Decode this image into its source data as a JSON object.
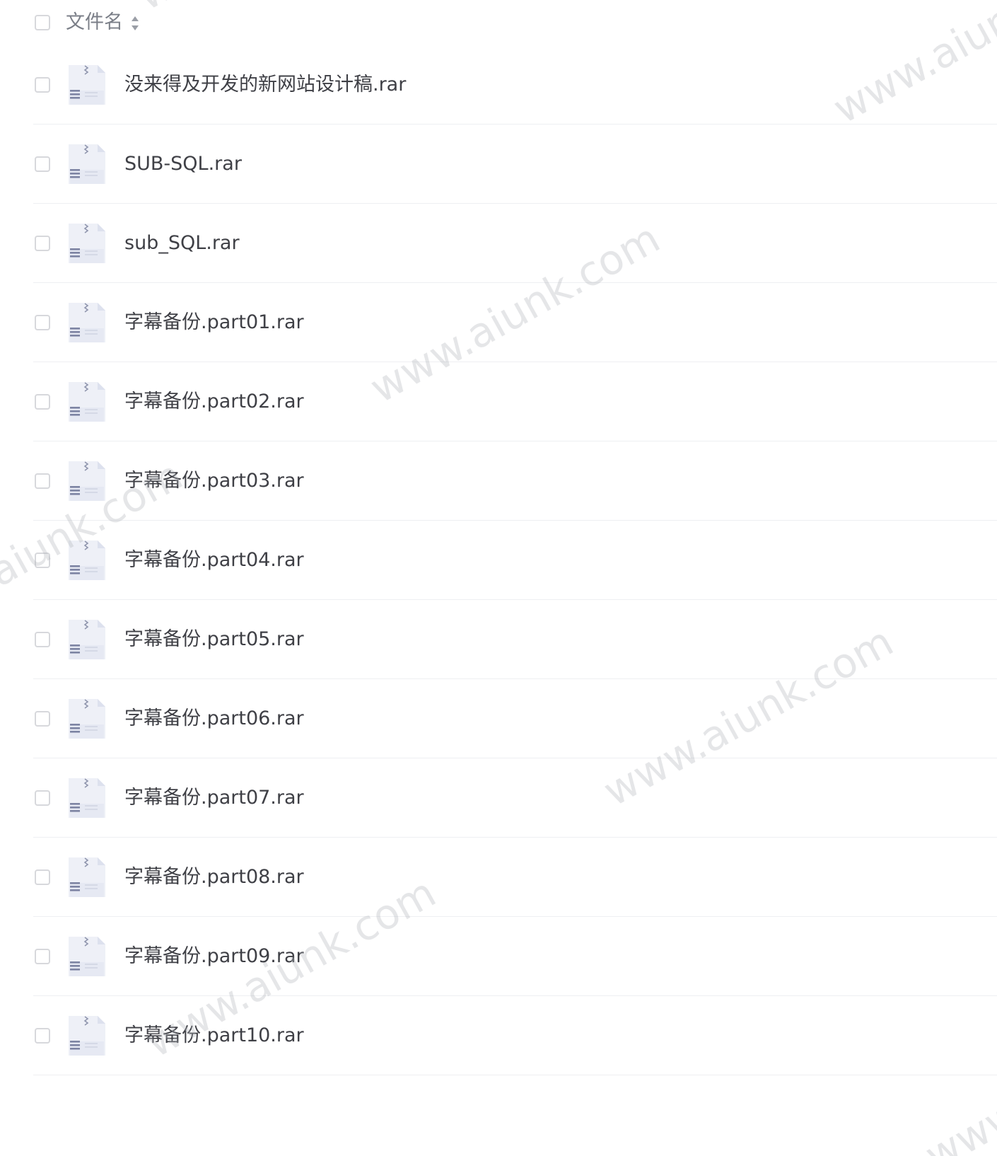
{
  "header": {
    "column_label": "文件名",
    "sort_icon": "sort-arrows-icon"
  },
  "file_icon": "rar-archive-icon",
  "files": [
    {
      "name": "没来得及开发的新网站设计稿.rar"
    },
    {
      "name": "SUB-SQL.rar"
    },
    {
      "name": "sub_SQL.rar"
    },
    {
      "name": "字幕备份.part01.rar"
    },
    {
      "name": "字幕备份.part02.rar"
    },
    {
      "name": "字幕备份.part03.rar"
    },
    {
      "name": "字幕备份.part04.rar"
    },
    {
      "name": "字幕备份.part05.rar"
    },
    {
      "name": "字幕备份.part06.rar"
    },
    {
      "name": "字幕备份.part07.rar"
    },
    {
      "name": "字幕备份.part08.rar"
    },
    {
      "name": "字幕备份.part09.rar"
    },
    {
      "name": "字幕备份.part10.rar"
    }
  ],
  "watermark": {
    "text": "www.aiunk.com"
  }
}
